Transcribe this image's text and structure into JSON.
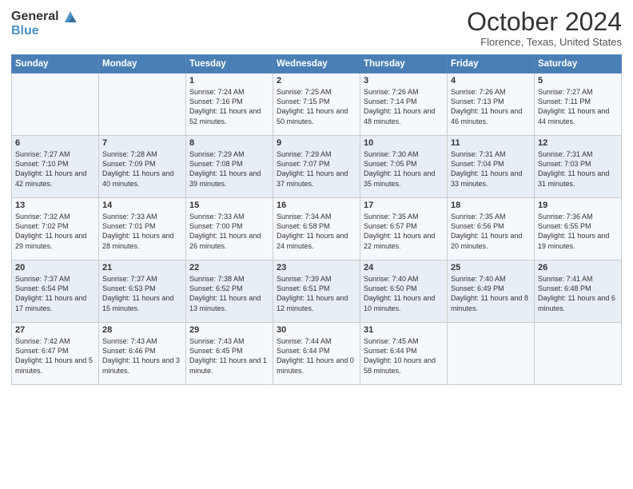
{
  "header": {
    "logo_line1": "General",
    "logo_line2": "Blue",
    "month": "October 2024",
    "location": "Florence, Texas, United States"
  },
  "weekdays": [
    "Sunday",
    "Monday",
    "Tuesday",
    "Wednesday",
    "Thursday",
    "Friday",
    "Saturday"
  ],
  "weeks": [
    [
      {
        "day": "",
        "sunrise": "",
        "sunset": "",
        "daylight": ""
      },
      {
        "day": "",
        "sunrise": "",
        "sunset": "",
        "daylight": ""
      },
      {
        "day": "1",
        "sunrise": "Sunrise: 7:24 AM",
        "sunset": "Sunset: 7:16 PM",
        "daylight": "Daylight: 11 hours and 52 minutes."
      },
      {
        "day": "2",
        "sunrise": "Sunrise: 7:25 AM",
        "sunset": "Sunset: 7:15 PM",
        "daylight": "Daylight: 11 hours and 50 minutes."
      },
      {
        "day": "3",
        "sunrise": "Sunrise: 7:26 AM",
        "sunset": "Sunset: 7:14 PM",
        "daylight": "Daylight: 11 hours and 48 minutes."
      },
      {
        "day": "4",
        "sunrise": "Sunrise: 7:26 AM",
        "sunset": "Sunset: 7:13 PM",
        "daylight": "Daylight: 11 hours and 46 minutes."
      },
      {
        "day": "5",
        "sunrise": "Sunrise: 7:27 AM",
        "sunset": "Sunset: 7:11 PM",
        "daylight": "Daylight: 11 hours and 44 minutes."
      }
    ],
    [
      {
        "day": "6",
        "sunrise": "Sunrise: 7:27 AM",
        "sunset": "Sunset: 7:10 PM",
        "daylight": "Daylight: 11 hours and 42 minutes."
      },
      {
        "day": "7",
        "sunrise": "Sunrise: 7:28 AM",
        "sunset": "Sunset: 7:09 PM",
        "daylight": "Daylight: 11 hours and 40 minutes."
      },
      {
        "day": "8",
        "sunrise": "Sunrise: 7:29 AM",
        "sunset": "Sunset: 7:08 PM",
        "daylight": "Daylight: 11 hours and 39 minutes."
      },
      {
        "day": "9",
        "sunrise": "Sunrise: 7:29 AM",
        "sunset": "Sunset: 7:07 PM",
        "daylight": "Daylight: 11 hours and 37 minutes."
      },
      {
        "day": "10",
        "sunrise": "Sunrise: 7:30 AM",
        "sunset": "Sunset: 7:05 PM",
        "daylight": "Daylight: 11 hours and 35 minutes."
      },
      {
        "day": "11",
        "sunrise": "Sunrise: 7:31 AM",
        "sunset": "Sunset: 7:04 PM",
        "daylight": "Daylight: 11 hours and 33 minutes."
      },
      {
        "day": "12",
        "sunrise": "Sunrise: 7:31 AM",
        "sunset": "Sunset: 7:03 PM",
        "daylight": "Daylight: 11 hours and 31 minutes."
      }
    ],
    [
      {
        "day": "13",
        "sunrise": "Sunrise: 7:32 AM",
        "sunset": "Sunset: 7:02 PM",
        "daylight": "Daylight: 11 hours and 29 minutes."
      },
      {
        "day": "14",
        "sunrise": "Sunrise: 7:33 AM",
        "sunset": "Sunset: 7:01 PM",
        "daylight": "Daylight: 11 hours and 28 minutes."
      },
      {
        "day": "15",
        "sunrise": "Sunrise: 7:33 AM",
        "sunset": "Sunset: 7:00 PM",
        "daylight": "Daylight: 11 hours and 26 minutes."
      },
      {
        "day": "16",
        "sunrise": "Sunrise: 7:34 AM",
        "sunset": "Sunset: 6:58 PM",
        "daylight": "Daylight: 11 hours and 24 minutes."
      },
      {
        "day": "17",
        "sunrise": "Sunrise: 7:35 AM",
        "sunset": "Sunset: 6:57 PM",
        "daylight": "Daylight: 11 hours and 22 minutes."
      },
      {
        "day": "18",
        "sunrise": "Sunrise: 7:35 AM",
        "sunset": "Sunset: 6:56 PM",
        "daylight": "Daylight: 11 hours and 20 minutes."
      },
      {
        "day": "19",
        "sunrise": "Sunrise: 7:36 AM",
        "sunset": "Sunset: 6:55 PM",
        "daylight": "Daylight: 11 hours and 19 minutes."
      }
    ],
    [
      {
        "day": "20",
        "sunrise": "Sunrise: 7:37 AM",
        "sunset": "Sunset: 6:54 PM",
        "daylight": "Daylight: 11 hours and 17 minutes."
      },
      {
        "day": "21",
        "sunrise": "Sunrise: 7:37 AM",
        "sunset": "Sunset: 6:53 PM",
        "daylight": "Daylight: 11 hours and 15 minutes."
      },
      {
        "day": "22",
        "sunrise": "Sunrise: 7:38 AM",
        "sunset": "Sunset: 6:52 PM",
        "daylight": "Daylight: 11 hours and 13 minutes."
      },
      {
        "day": "23",
        "sunrise": "Sunrise: 7:39 AM",
        "sunset": "Sunset: 6:51 PM",
        "daylight": "Daylight: 11 hours and 12 minutes."
      },
      {
        "day": "24",
        "sunrise": "Sunrise: 7:40 AM",
        "sunset": "Sunset: 6:50 PM",
        "daylight": "Daylight: 11 hours and 10 minutes."
      },
      {
        "day": "25",
        "sunrise": "Sunrise: 7:40 AM",
        "sunset": "Sunset: 6:49 PM",
        "daylight": "Daylight: 11 hours and 8 minutes."
      },
      {
        "day": "26",
        "sunrise": "Sunrise: 7:41 AM",
        "sunset": "Sunset: 6:48 PM",
        "daylight": "Daylight: 11 hours and 6 minutes."
      }
    ],
    [
      {
        "day": "27",
        "sunrise": "Sunrise: 7:42 AM",
        "sunset": "Sunset: 6:47 PM",
        "daylight": "Daylight: 11 hours and 5 minutes."
      },
      {
        "day": "28",
        "sunrise": "Sunrise: 7:43 AM",
        "sunset": "Sunset: 6:46 PM",
        "daylight": "Daylight: 11 hours and 3 minutes."
      },
      {
        "day": "29",
        "sunrise": "Sunrise: 7:43 AM",
        "sunset": "Sunset: 6:45 PM",
        "daylight": "Daylight: 11 hours and 1 minute."
      },
      {
        "day": "30",
        "sunrise": "Sunrise: 7:44 AM",
        "sunset": "Sunset: 6:44 PM",
        "daylight": "Daylight: 11 hours and 0 minutes."
      },
      {
        "day": "31",
        "sunrise": "Sunrise: 7:45 AM",
        "sunset": "Sunset: 6:44 PM",
        "daylight": "Daylight: 10 hours and 58 minutes."
      },
      {
        "day": "",
        "sunrise": "",
        "sunset": "",
        "daylight": ""
      },
      {
        "day": "",
        "sunrise": "",
        "sunset": "",
        "daylight": ""
      }
    ]
  ]
}
